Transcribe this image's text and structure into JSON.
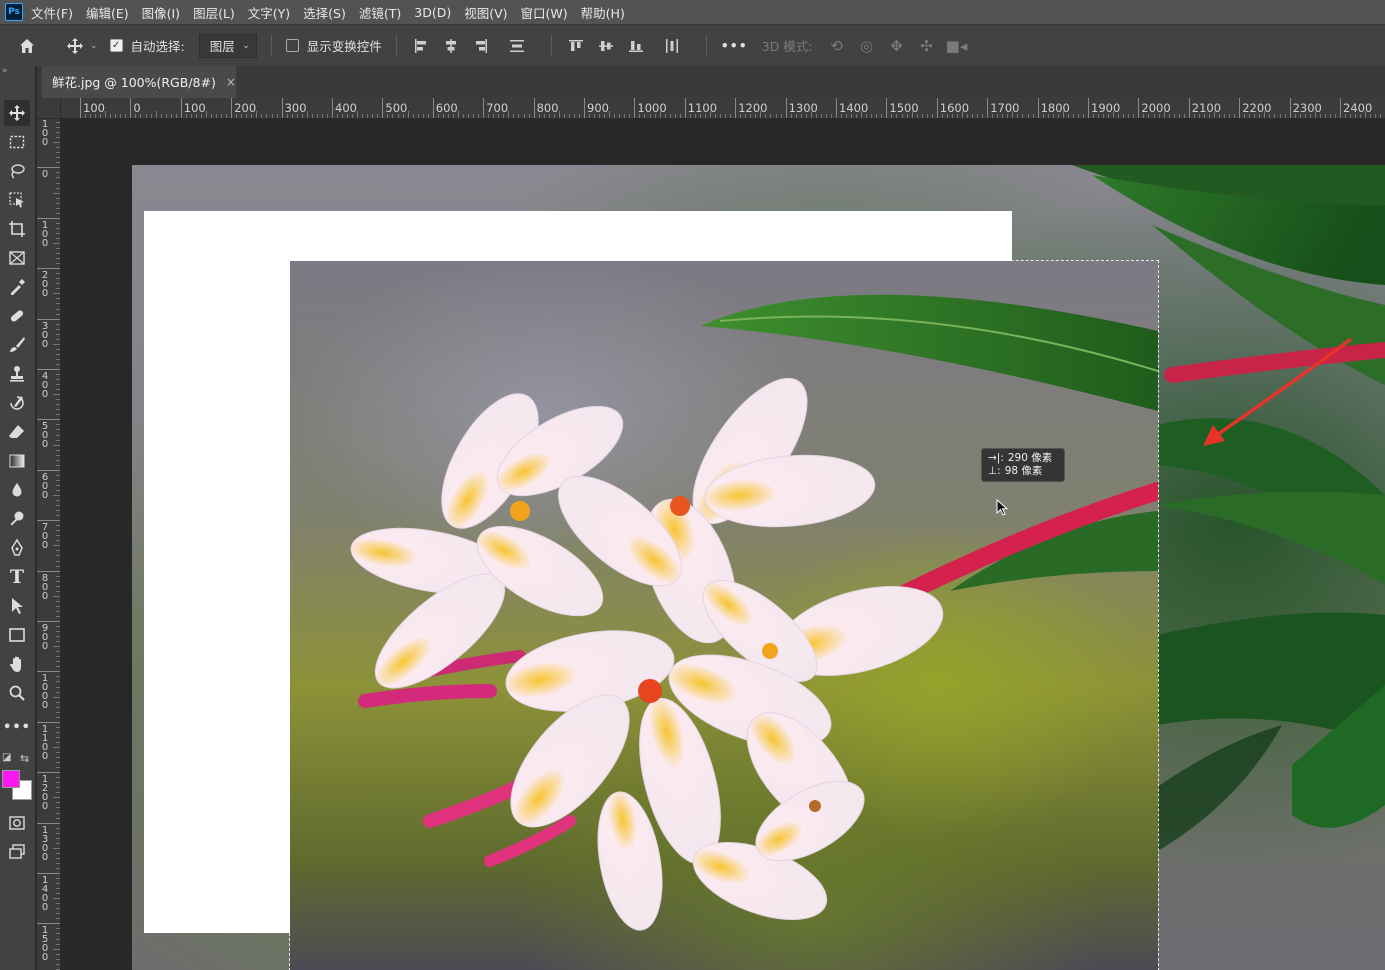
{
  "app": {
    "logo": "Ps"
  },
  "menu": [
    "文件(F)",
    "编辑(E)",
    "图像(I)",
    "图层(L)",
    "文字(Y)",
    "选择(S)",
    "滤镜(T)",
    "3D(D)",
    "视图(V)",
    "窗口(W)",
    "帮助(H)"
  ],
  "options": {
    "auto_select_label": "自动选择:",
    "auto_select_checked": true,
    "layer_select_value": "图层",
    "show_transform_label": "显示变换控件",
    "show_transform_checked": false,
    "more": "•••",
    "mode_3d_label": "3D 模式:"
  },
  "tab": {
    "title": "鲜花.jpg @ 100%(RGB/8#)",
    "close": "×"
  },
  "ruler": {
    "h_labels": [
      "100",
      "0",
      "100",
      "200",
      "300",
      "400",
      "500",
      "600",
      "700",
      "800",
      "900",
      "1000",
      "1100",
      "1200",
      "1300",
      "1400",
      "1500",
      "1600",
      "1700",
      "1800",
      "1900",
      "2000",
      "2100",
      "2200",
      "2300",
      "2400"
    ],
    "v_labels": [
      "100",
      "0",
      "100",
      "200",
      "300",
      "400",
      "500",
      "600",
      "700",
      "800",
      "900",
      "1000",
      "1100",
      "1200",
      "1300",
      "1400",
      "1500"
    ]
  },
  "colors": {
    "foreground": "#ff17f2",
    "background": "#ffffff"
  },
  "measure": {
    "dx_icon": "→|:",
    "dx": "290 像素",
    "dy_icon": "⊥:",
    "dy": "98 像素"
  }
}
